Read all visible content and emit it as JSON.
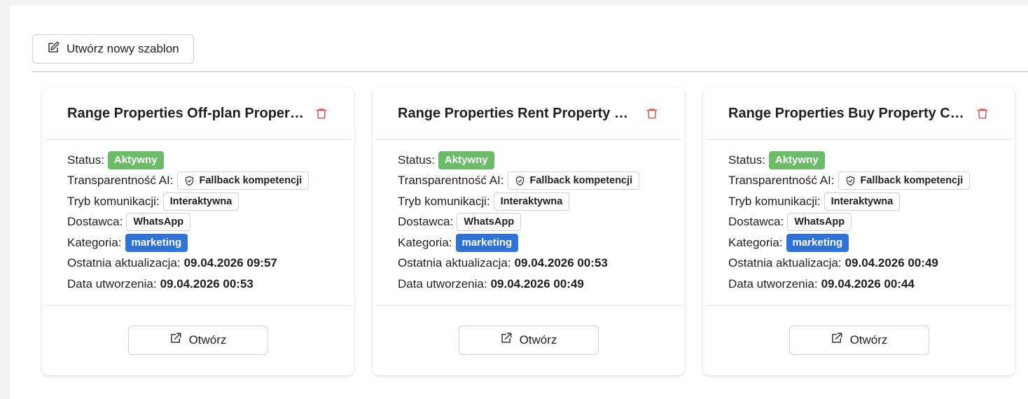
{
  "toolbar": {
    "create_label": "Utwórz nowy szablon"
  },
  "labels": {
    "status": "Status:",
    "ai_transparency": "Transparentność AI:",
    "comm_mode": "Tryb komunikacji:",
    "provider": "Dostawca:",
    "category": "Kategoria:",
    "last_updated": "Ostatnia aktualizacja:",
    "created": "Data utworzenia:",
    "open": "Otwórz"
  },
  "colors": {
    "status_green": "#6cbb68",
    "category_blue": "#2f73d6",
    "trash_red": "#d9534f"
  },
  "cards": [
    {
      "title": "Range Properties Off-plan Property Campaign",
      "status": "Aktywny",
      "ai_transparency": "Fallback kompetencji",
      "comm_mode": "Interaktywna",
      "provider": "WhatsApp",
      "category": "marketing",
      "last_updated": "09.04.2026 09:57",
      "created": "09.04.2026 00:53"
    },
    {
      "title": "Range Properties Rent Property Campaign",
      "status": "Aktywny",
      "ai_transparency": "Fallback kompetencji",
      "comm_mode": "Interaktywna",
      "provider": "WhatsApp",
      "category": "marketing",
      "last_updated": "09.04.2026 00:53",
      "created": "09.04.2026 00:49"
    },
    {
      "title": "Range Properties Buy Property Campaign",
      "status": "Aktywny",
      "ai_transparency": "Fallback kompetencji",
      "comm_mode": "Interaktywna",
      "provider": "WhatsApp",
      "category": "marketing",
      "last_updated": "09.04.2026 00:49",
      "created": "09.04.2026 00:44"
    }
  ]
}
